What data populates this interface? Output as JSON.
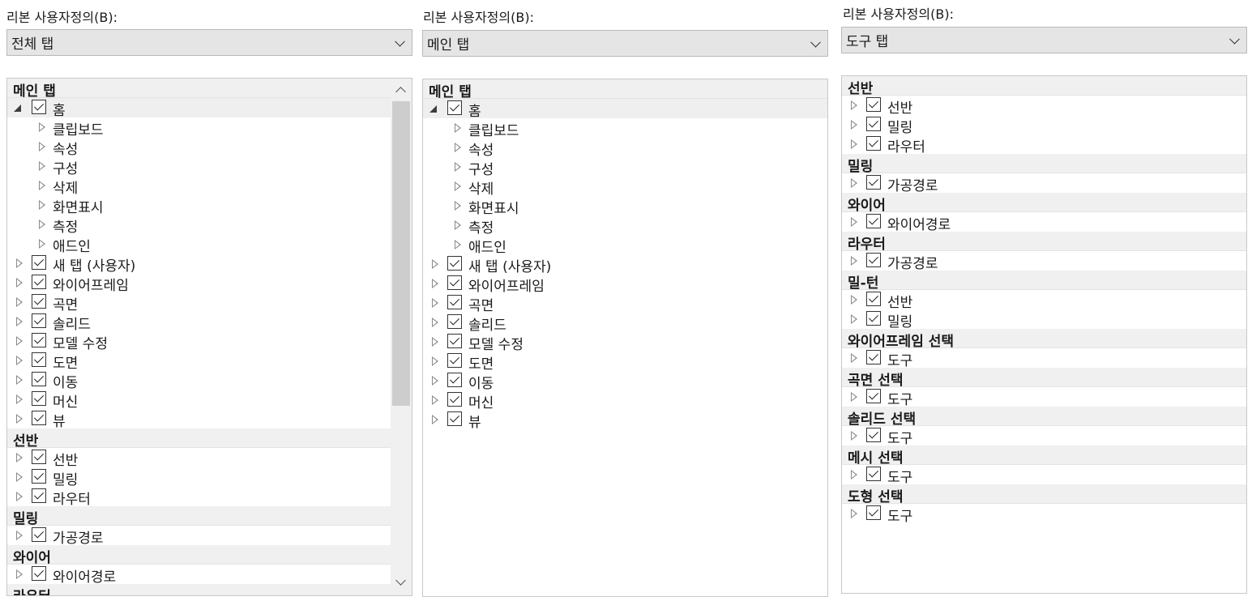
{
  "panels": [
    {
      "label": "리본 사용자정의(B):",
      "dropdown": "전체 탭",
      "scrollbar": true,
      "items": [
        {
          "type": "group",
          "text": "메인 탭"
        },
        {
          "type": "tab",
          "text": "홈",
          "expanded": true,
          "selected": true
        },
        {
          "type": "child",
          "text": "클립보드"
        },
        {
          "type": "child",
          "text": "속성"
        },
        {
          "type": "child",
          "text": "구성"
        },
        {
          "type": "child",
          "text": "삭제"
        },
        {
          "type": "child",
          "text": "화면표시"
        },
        {
          "type": "child",
          "text": "측정"
        },
        {
          "type": "child",
          "text": "애드인"
        },
        {
          "type": "tab",
          "text": "새 탭 (사용자)"
        },
        {
          "type": "tab",
          "text": "와이어프레임"
        },
        {
          "type": "tab",
          "text": "곡면"
        },
        {
          "type": "tab",
          "text": "솔리드"
        },
        {
          "type": "tab",
          "text": "모델 수정"
        },
        {
          "type": "tab",
          "text": "도면"
        },
        {
          "type": "tab",
          "text": "이동"
        },
        {
          "type": "tab",
          "text": "머신"
        },
        {
          "type": "tab",
          "text": "뷰"
        },
        {
          "type": "group",
          "text": "선반"
        },
        {
          "type": "tab",
          "text": "선반"
        },
        {
          "type": "tab",
          "text": "밀링"
        },
        {
          "type": "tab",
          "text": "라우터"
        },
        {
          "type": "group",
          "text": "밀링"
        },
        {
          "type": "tab",
          "text": "가공경로"
        },
        {
          "type": "group",
          "text": "와이어"
        },
        {
          "type": "tab",
          "text": "와이어경로"
        },
        {
          "type": "group",
          "text": "라우터"
        }
      ]
    },
    {
      "label": "리본 사용자정의(B):",
      "dropdown": "메인 탭",
      "scrollbar": false,
      "items": [
        {
          "type": "group",
          "text": "메인 탭"
        },
        {
          "type": "tab",
          "text": "홈",
          "expanded": true,
          "selected": true
        },
        {
          "type": "child",
          "text": "클립보드"
        },
        {
          "type": "child",
          "text": "속성"
        },
        {
          "type": "child",
          "text": "구성"
        },
        {
          "type": "child",
          "text": "삭제"
        },
        {
          "type": "child",
          "text": "화면표시"
        },
        {
          "type": "child",
          "text": "측정"
        },
        {
          "type": "child",
          "text": "애드인"
        },
        {
          "type": "tab",
          "text": "새 탭 (사용자)"
        },
        {
          "type": "tab",
          "text": "와이어프레임"
        },
        {
          "type": "tab",
          "text": "곡면"
        },
        {
          "type": "tab",
          "text": "솔리드"
        },
        {
          "type": "tab",
          "text": "모델 수정"
        },
        {
          "type": "tab",
          "text": "도면"
        },
        {
          "type": "tab",
          "text": "이동"
        },
        {
          "type": "tab",
          "text": "머신"
        },
        {
          "type": "tab",
          "text": "뷰"
        }
      ]
    },
    {
      "label": "리본 사용자정의(B):",
      "dropdown": "도구 탭",
      "scrollbar": false,
      "items": [
        {
          "type": "group",
          "text": "선반"
        },
        {
          "type": "tab",
          "text": "선반"
        },
        {
          "type": "tab",
          "text": "밀링"
        },
        {
          "type": "tab",
          "text": "라우터"
        },
        {
          "type": "group",
          "text": "밀링"
        },
        {
          "type": "tab",
          "text": "가공경로"
        },
        {
          "type": "group",
          "text": "와이어"
        },
        {
          "type": "tab",
          "text": "와이어경로"
        },
        {
          "type": "group",
          "text": "라우터"
        },
        {
          "type": "tab",
          "text": "가공경로"
        },
        {
          "type": "group",
          "text": "밀-턴"
        },
        {
          "type": "tab",
          "text": "선반"
        },
        {
          "type": "tab",
          "text": "밀링"
        },
        {
          "type": "group",
          "text": "와이어프레임 선택"
        },
        {
          "type": "tab",
          "text": "도구"
        },
        {
          "type": "group",
          "text": "곡면 선택"
        },
        {
          "type": "tab",
          "text": "도구"
        },
        {
          "type": "group",
          "text": "솔리드 선택"
        },
        {
          "type": "tab",
          "text": "도구"
        },
        {
          "type": "group",
          "text": "메시 선택"
        },
        {
          "type": "tab",
          "text": "도구"
        },
        {
          "type": "group",
          "text": "도형 선택"
        },
        {
          "type": "tab",
          "text": "도구"
        }
      ]
    }
  ]
}
